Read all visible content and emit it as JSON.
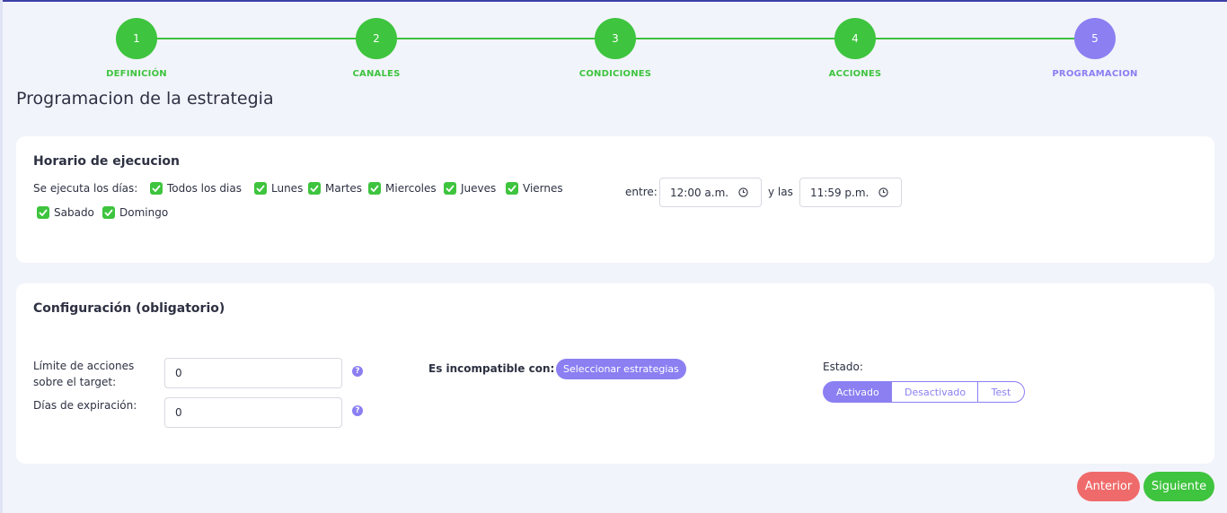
{
  "stepper": {
    "steps": [
      {
        "number": "1",
        "label": "DEFINICIÓN"
      },
      {
        "number": "2",
        "label": "CANALES"
      },
      {
        "number": "3",
        "label": "CONDICIONES"
      },
      {
        "number": "4",
        "label": "ACCIONES"
      },
      {
        "number": "5",
        "label": "PROGRAMACION"
      }
    ],
    "active_step": 5
  },
  "page_title": "Programacion de la estrategia",
  "schedule": {
    "title": "Horario de ejecucion",
    "days_label": "Se ejecuta los días:",
    "days": [
      {
        "label": "Todos los dias",
        "checked": true
      },
      {
        "label": "Lunes",
        "checked": true
      },
      {
        "label": "Martes",
        "checked": true
      },
      {
        "label": "Miercoles",
        "checked": true
      },
      {
        "label": "Jueves",
        "checked": true
      },
      {
        "label": "Viernes",
        "checked": true
      },
      {
        "label": "Sabado",
        "checked": true
      },
      {
        "label": "Domingo",
        "checked": true
      }
    ],
    "between_label": "entre:",
    "start_time": "12:00 a.m.",
    "and_label": "y las",
    "end_time": "11:59 p.m."
  },
  "config": {
    "title": "Configuración (obligatorio)",
    "limit_label_line1": "Límite de acciones",
    "limit_label_line2": "sobre el target:",
    "limit_value": "0",
    "expiration_label": "Días de expiración:",
    "expiration_value": "0",
    "help_icon": "?",
    "incompatible_label": "Es incompatible con:",
    "select_strategies_button": "Seleccionar estrategias",
    "status_label": "Estado:",
    "status_options": [
      "Activado",
      "Desactivado",
      "Test"
    ],
    "status_selected": "Activado"
  },
  "footer": {
    "prev_button": "Anterior",
    "next_button": "Siguiente"
  },
  "colors": {
    "green": "#3ec43e",
    "purple": "#8b7ff2",
    "red": "#ef6b6b",
    "background": "#f2f4fb"
  }
}
